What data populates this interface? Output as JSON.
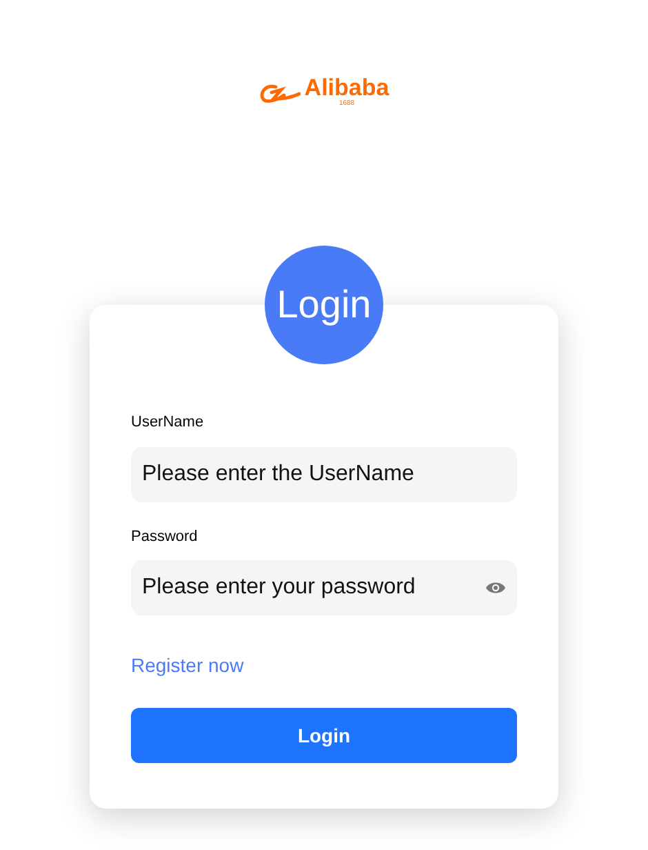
{
  "logo": {
    "name": "Alibaba",
    "sub": "1688"
  },
  "badge": {
    "title": "Login"
  },
  "fields": [
    {
      "label": "UserName",
      "placeholder": "Please enter the UserName",
      "kind": "text"
    },
    {
      "label": "Password",
      "placeholder": "Please enter your password",
      "kind": "password"
    }
  ],
  "register_link": "Register now",
  "submit": "Login"
}
